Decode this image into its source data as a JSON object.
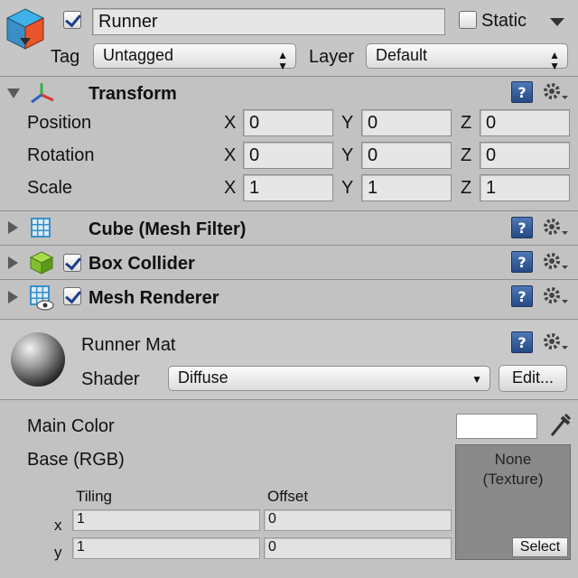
{
  "header": {
    "object_name": "Runner",
    "active_checked": true,
    "static_label": "Static",
    "static_checked": false,
    "tag_label": "Tag",
    "tag_value": "Untagged",
    "layer_label": "Layer",
    "layer_value": "Default"
  },
  "transform": {
    "title": "Transform",
    "rows": [
      {
        "label": "Position",
        "x": "0",
        "y": "0",
        "z": "0"
      },
      {
        "label": "Rotation",
        "x": "0",
        "y": "0",
        "z": "0"
      },
      {
        "label": "Scale",
        "x": "1",
        "y": "1",
        "z": "1"
      }
    ],
    "axis_x": "X",
    "axis_y": "Y",
    "axis_z": "Z"
  },
  "components": [
    {
      "title": "Cube (Mesh Filter)",
      "has_checkbox": false
    },
    {
      "title": "Box Collider",
      "has_checkbox": true,
      "checked": true
    },
    {
      "title": "Mesh Renderer",
      "has_checkbox": true,
      "checked": true
    }
  ],
  "material": {
    "name": "Runner Mat",
    "shader_label": "Shader",
    "shader_value": "Diffuse",
    "edit_label": "Edit...",
    "main_color_label": "Main Color",
    "main_color": "#ffffff",
    "base_label": "Base (RGB)",
    "tiling_label": "Tiling",
    "offset_label": "Offset",
    "x_label": "x",
    "y_label": "y",
    "tiling_x": "1",
    "tiling_y": "1",
    "offset_x": "0",
    "offset_y": "0",
    "texture_none": "None",
    "texture_type": "(Texture)",
    "select_label": "Select"
  },
  "colors": {
    "panel": "#c2c2c2",
    "help_icon": "#2f5796",
    "texture_slot": "#8a8a8a"
  }
}
